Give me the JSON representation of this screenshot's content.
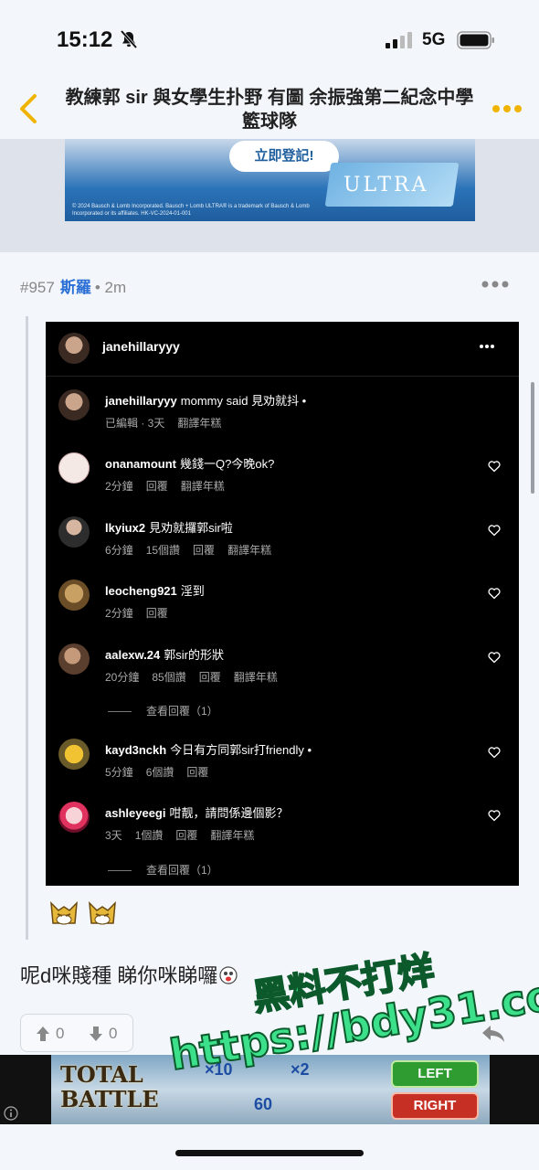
{
  "status_bar": {
    "time": "15:12",
    "network": "5G"
  },
  "header": {
    "title": "教練郭 sir 與女學生扑野 有圖 余振強第二紀念中學籃球隊"
  },
  "ad_top": {
    "cta": "立即登記!",
    "brand": "ULTRA",
    "fine_print": "© 2024 Bausch & Lomb Incorporated. Bausch + Lomb ULTRA® is a trademark of Bausch & Lomb Incorporated or its affiliates. HK-VC-2024-01-001"
  },
  "post": {
    "number": "#957",
    "author": "斯羅",
    "time": "• 2m",
    "body": "呢d咪賤種 睇你咪睇囉",
    "votes": {
      "up": "0",
      "down": "0"
    }
  },
  "instagram": {
    "header_user": "janehillaryyy",
    "comments": [
      {
        "user": "janehillaryyy",
        "text": "mommy said 見劝就抖 •",
        "meta": [
          "已編輯 · 3天",
          "翻譯年糕"
        ]
      },
      {
        "user": "onanamount",
        "text": "幾錢一Q?今晚ok?",
        "meta": [
          "2分鐘",
          "回覆",
          "翻譯年糕"
        ]
      },
      {
        "user": "lkyiux2",
        "text": "見劝就攞郭sir啦",
        "meta": [
          "6分鐘",
          "15個讚",
          "回覆",
          "翻譯年糕"
        ]
      },
      {
        "user": "leocheng921",
        "text": "淫到",
        "meta": [
          "2分鐘",
          "回覆"
        ]
      },
      {
        "user": "aalexw.24",
        "text": "郭sir的形狀",
        "meta": [
          "20分鐘",
          "85個讚",
          "回覆",
          "翻譯年糕"
        ]
      },
      {
        "user": "kayd3nckh",
        "text": "今日有方同郭sir打friendly •",
        "meta": [
          "5分鐘",
          "6個讚",
          "回覆"
        ]
      },
      {
        "user": "ashleyeegi",
        "text": "咁靓，請問係邊個影？",
        "meta": [
          "3天",
          "1個讚",
          "回覆",
          "翻譯年糕"
        ]
      }
    ],
    "view_replies": [
      "查看回覆（1）",
      "查看回覆（1）"
    ]
  },
  "ad_bottom": {
    "title_line1": "TOTAL",
    "title_line2": "BATTLE",
    "multiplier_a": "×10",
    "multiplier_b": "×2",
    "count": "60",
    "left_label": "LEFT",
    "right_label": "RIGHT"
  },
  "watermark": {
    "line1": "黑料不打烊",
    "line2": "https://bdy31.co"
  },
  "colors": {
    "author": "#2b6fd6",
    "back": "#f0b400",
    "more": "#f0b400",
    "watermark": "#3de08a"
  }
}
